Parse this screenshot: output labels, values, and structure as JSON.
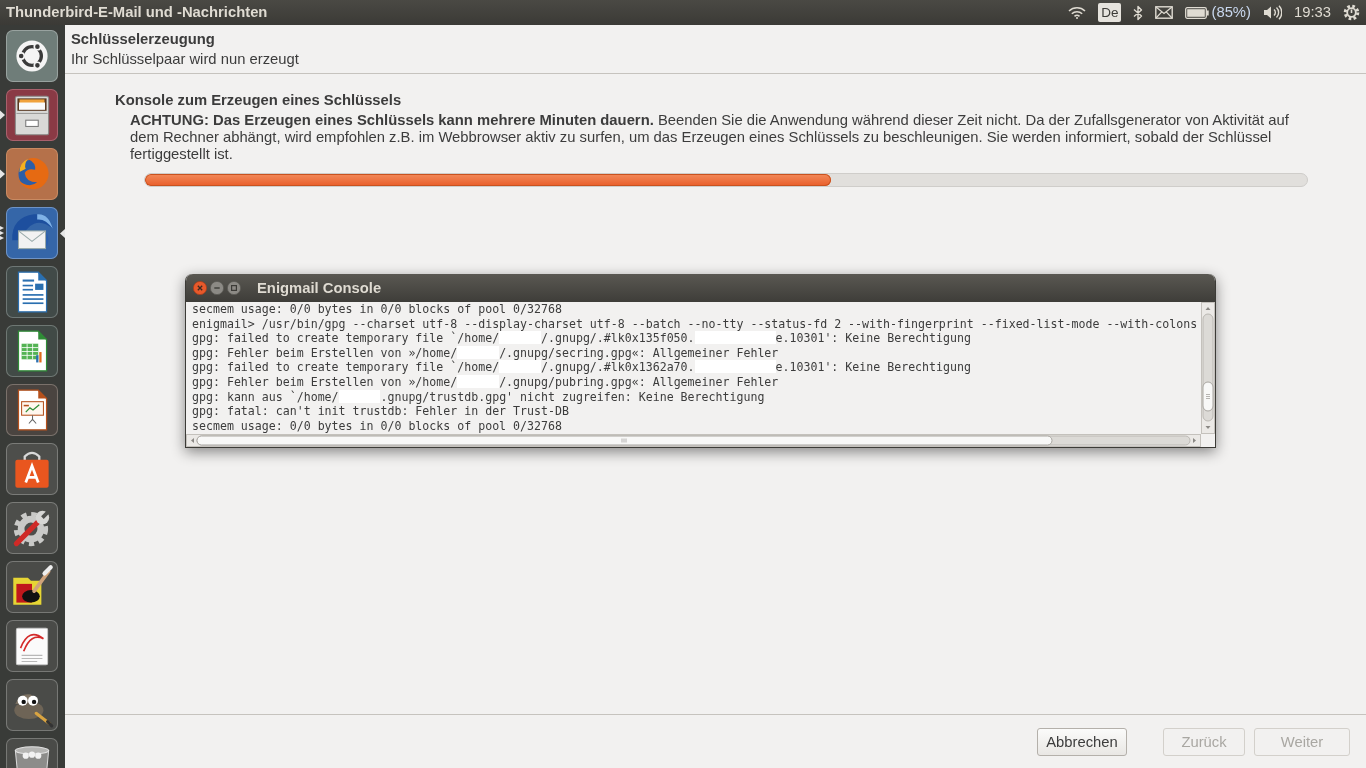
{
  "top_panel": {
    "title": "Thunderbird-E-Mail und -Nachrichten",
    "keyboard_layout": "De",
    "battery_percent": "(85%)",
    "clock": "19:33"
  },
  "launcher": {
    "items": [
      {
        "kind": "dash",
        "running": false,
        "multiple_windows": false,
        "focused": false
      },
      {
        "kind": "files",
        "running": true,
        "multiple_windows": false,
        "focused": false
      },
      {
        "kind": "browser",
        "running": true,
        "multiple_windows": false,
        "focused": false
      },
      {
        "kind": "mail",
        "running": true,
        "multiple_windows": true,
        "focused": true
      },
      {
        "kind": "writer",
        "running": false,
        "multiple_windows": false,
        "focused": false
      },
      {
        "kind": "calc",
        "running": false,
        "multiple_windows": false,
        "focused": false
      },
      {
        "kind": "impress",
        "running": false,
        "multiple_windows": false,
        "focused": false
      },
      {
        "kind": "software",
        "running": false,
        "multiple_windows": false,
        "focused": false
      },
      {
        "kind": "settings",
        "running": false,
        "multiple_windows": false,
        "focused": false
      },
      {
        "kind": "paint",
        "running": false,
        "multiple_windows": false,
        "focused": false
      },
      {
        "kind": "viewer",
        "running": false,
        "multiple_windows": false,
        "focused": false
      },
      {
        "kind": "gimp",
        "running": false,
        "multiple_windows": false,
        "focused": false
      },
      {
        "kind": "trash",
        "running": false,
        "multiple_windows": false,
        "focused": false
      }
    ]
  },
  "wizard_header": {
    "title": "Schlüsselerzeugung",
    "subtitle": "Ihr Schlüsselpaar wird nun erzeugt"
  },
  "key_console": {
    "title": "Konsole zum Erzeugen eines Schlüssels",
    "notice": "**ACHTUNG: Das Erzeugen eines Schlüssels kann mehrere Minuten dauern.** Beenden Sie die Anwendung während dieser Zeit nicht. Da der Zufallsgenerator von Aktivität auf dem Rechner abhängt, wird empfohlen z.B. im Webbrowser aktiv zu surfen, um das Erzeugen eines Schlüssels zu beschleunigen. Sie werden informiert, sobald der Schlüssel fertiggestellt ist.",
    "progress": {
      "level": 0.59
    }
  },
  "console_window": {
    "title": "Enigmail Console",
    "lines": [
      {
        "segments": [
          {
            "kind": "text",
            "text": "secmem usage: 0/0 bytes in 0/0 blocks of pool 0/32768"
          }
        ]
      },
      {
        "segments": [
          {
            "kind": "text",
            "text": "enigmail> /usr/bin/gpg --charset utf-8 --display-charset utf-8 --batch --no-tty --status-fd 2 --with-fingerprint --fixed-list-mode --with-colons"
          }
        ]
      },
      {
        "segments": [
          {
            "kind": "text",
            "text": "gpg: failed to create temporary file `/home/"
          },
          {
            "kind": "redacted"
          },
          {
            "kind": "text",
            "text": "/.gnupg/.#lk0x135f050."
          },
          {
            "kind": "redacted"
          },
          {
            "kind": "text",
            "text": "e.10301': Keine Berechtigung"
          }
        ]
      },
      {
        "segments": [
          {
            "kind": "text",
            "text": "gpg: Fehler beim Erstellen von »/home/"
          },
          {
            "kind": "redacted"
          },
          {
            "kind": "text",
            "text": "/.gnupg/secring.gpg«: Allgemeiner Fehler"
          }
        ]
      },
      {
        "segments": [
          {
            "kind": "text",
            "text": "gpg: failed to create temporary file `/home/"
          },
          {
            "kind": "redacted"
          },
          {
            "kind": "text",
            "text": "/.gnupg/.#lk0x1362a70."
          },
          {
            "kind": "redacted"
          },
          {
            "kind": "text",
            "text": "e.10301': Keine Berechtigung"
          }
        ]
      },
      {
        "segments": [
          {
            "kind": "text",
            "text": "gpg: Fehler beim Erstellen von »/home/"
          },
          {
            "kind": "redacted"
          },
          {
            "kind": "text",
            "text": "/.gnupg/pubring.gpg«: Allgemeiner Fehler"
          }
        ]
      },
      {
        "segments": [
          {
            "kind": "text",
            "text": "gpg: kann aus `/home/"
          },
          {
            "kind": "redacted"
          },
          {
            "kind": "text",
            "text": ".gnupg/trustdb.gpg' nicht zugreifen: Keine Berechtigung"
          }
        ]
      },
      {
        "segments": [
          {
            "kind": "text",
            "text": "gpg: fatal: can't init trustdb: Fehler in der Trust-DB"
          }
        ]
      },
      {
        "segments": [
          {
            "kind": "text",
            "text": "secmem usage: 0/0 bytes in 0/0 blocks of pool 0/32768"
          }
        ]
      }
    ]
  },
  "buttons": [
    {
      "label": "Abbrechen",
      "disabled": false
    },
    {
      "label": "Zurück",
      "disabled": true
    },
    {
      "label": "Weiter",
      "disabled": true
    }
  ]
}
